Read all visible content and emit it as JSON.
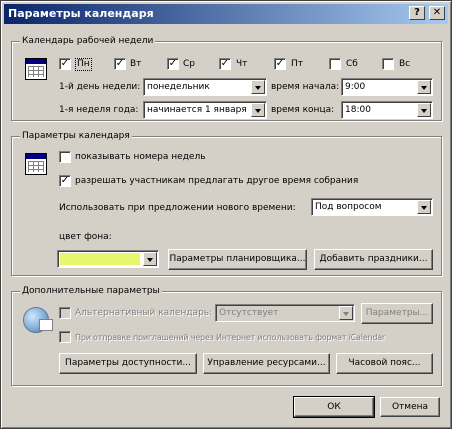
{
  "window": {
    "title": "Параметры календаря",
    "help_label": "?",
    "close_label": "✕"
  },
  "work_week": {
    "legend": "Календарь рабочей недели",
    "days": [
      {
        "label": "Пн",
        "checked": true
      },
      {
        "label": "Вт",
        "checked": true
      },
      {
        "label": "Ср",
        "checked": true
      },
      {
        "label": "Чт",
        "checked": true
      },
      {
        "label": "Пт",
        "checked": true
      },
      {
        "label": "Сб",
        "checked": false
      },
      {
        "label": "Вс",
        "checked": false
      }
    ],
    "first_day_label": "1-й день недели:",
    "first_day_value": "понедельник",
    "start_time_label": "время начала:",
    "start_time_value": "9:00",
    "first_week_label": "1-я неделя года:",
    "first_week_value": "начинается 1 января",
    "end_time_label": "время конца:",
    "end_time_value": "18:00"
  },
  "calendar_options": {
    "legend": "Параметры календаря",
    "show_week_numbers_label": "показывать номера недель",
    "show_week_numbers_checked": false,
    "allow_propose_label": "разрешать участникам предлагать другое время собрания",
    "allow_propose_checked": true,
    "propose_use_label": "Использовать при предложении нового времени:",
    "propose_use_value": "Под вопросом",
    "background_label": "цвет фона:",
    "background_color": "#e8f56e",
    "scheduler_button": "Параметры планировщика...",
    "add_holidays_button": "Добавить праздники..."
  },
  "advanced": {
    "legend": "Дополнительные параметры",
    "alt_calendar_label": "Альтернативный календарь:",
    "alt_calendar_value": "Отсутствует",
    "alt_params_button": "Параметры...",
    "icalendar_label": "При отправке приглашений через Интернет использовать формат iCalendar",
    "availability_button": "Параметры доступности...",
    "resources_button": "Управление ресурсами...",
    "timezone_button": "Часовой пояс..."
  },
  "footer": {
    "ok_button": "ОК",
    "cancel_button": "Отмена"
  }
}
